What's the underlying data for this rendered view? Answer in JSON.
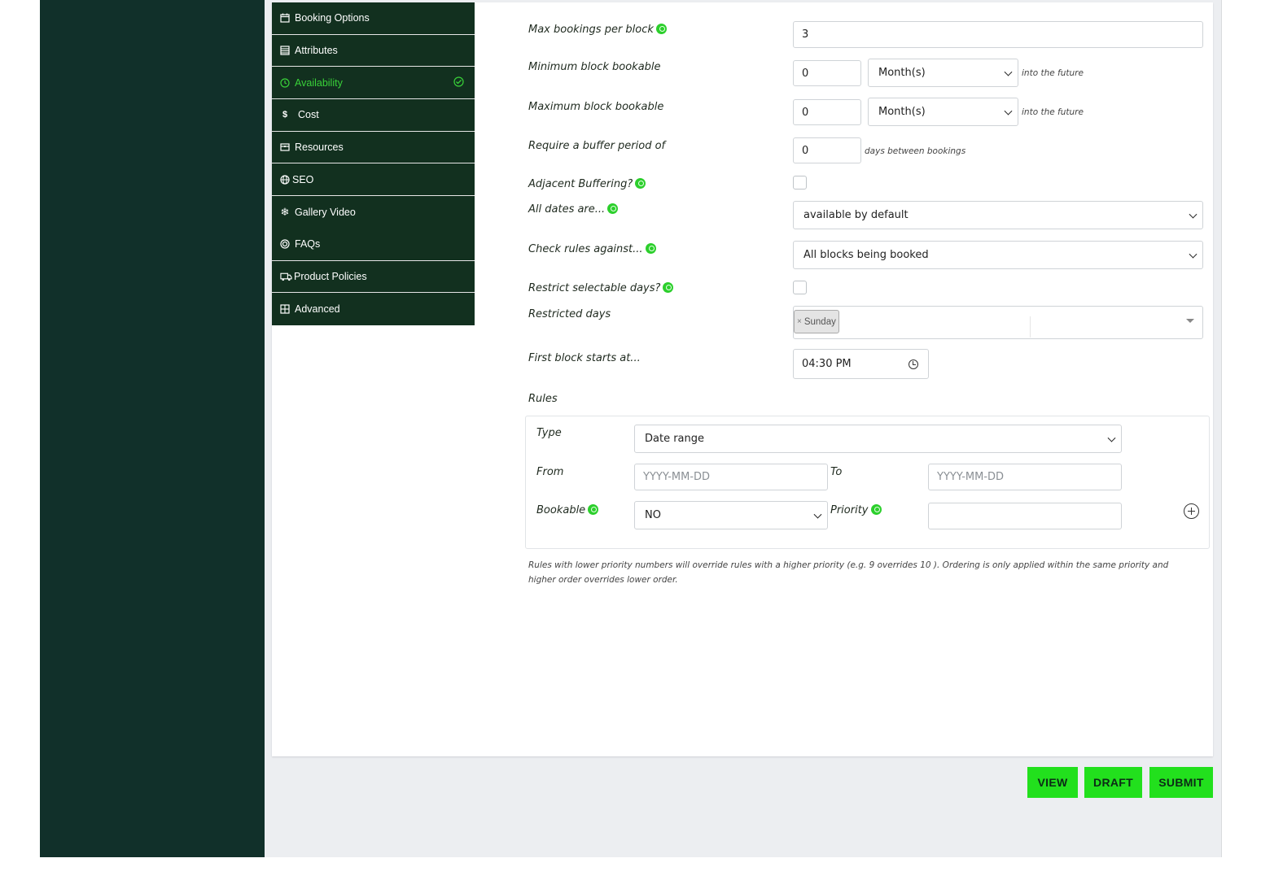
{
  "tabs": [
    {
      "label": "Booking Options",
      "icon": "calendar-icon"
    },
    {
      "label": "Attributes",
      "icon": "list-icon"
    },
    {
      "label": "Availability",
      "icon": "clock-icon",
      "active": true
    },
    {
      "label": "Cost",
      "icon": "dollar-icon"
    },
    {
      "label": "Resources",
      "icon": "box-icon"
    },
    {
      "label": "SEO",
      "icon": "globe-icon"
    },
    {
      "label": "Gallery Video",
      "icon": "snowflake-icon"
    },
    {
      "label": "FAQs",
      "icon": "target-icon"
    },
    {
      "label": "Product Policies",
      "icon": "truck-icon"
    },
    {
      "label": "Advanced",
      "icon": "grid-icon"
    }
  ],
  "form": {
    "max_bookings_label": "Max bookings per block",
    "max_bookings_value": "3",
    "min_block_label": "Minimum block bookable",
    "min_block_value": "0",
    "min_block_unit": "Month(s)",
    "max_block_label": "Maximum block bookable",
    "max_block_value": "0",
    "max_block_unit": "Month(s)",
    "into_future": "into the future",
    "buffer_label": "Require a buffer period of",
    "buffer_value": "0",
    "buffer_hint": "days between bookings",
    "adjacent_label": "Adjacent Buffering?",
    "all_dates_label": "All dates are...",
    "all_dates_value": "available by default",
    "check_rules_label": "Check rules against...",
    "check_rules_value": "All blocks being booked",
    "restrict_days_label": "Restrict selectable days?",
    "restricted_days_label": "Restricted days",
    "restricted_day_tag": "Sunday",
    "tag_remove": "×",
    "first_block_label": "First block starts at...",
    "first_block_value": "04:30 PM",
    "rules_label": "Rules"
  },
  "rules": {
    "type_label": "Type",
    "type_value": "Date range",
    "from_label": "From",
    "from_placeholder": "YYYY-MM-DD",
    "to_label": "To",
    "to_placeholder": "YYYY-MM-DD",
    "bookable_label": "Bookable",
    "bookable_value": "NO",
    "priority_label": "Priority",
    "priority_value": ""
  },
  "note": "Rules with lower priority numbers will override rules with a higher priority (e.g. 9 overrides 10 ). Ordering is only applied within the same priority and higher order overrides lower order.",
  "buttons": {
    "view": "VIEW",
    "draft": "DRAFT",
    "submit": "SUBMIT"
  },
  "colors": {
    "sidebar": "#11302a",
    "tab_bg": "#12301f",
    "accent": "#22e01d",
    "active_text": "#39d239"
  }
}
